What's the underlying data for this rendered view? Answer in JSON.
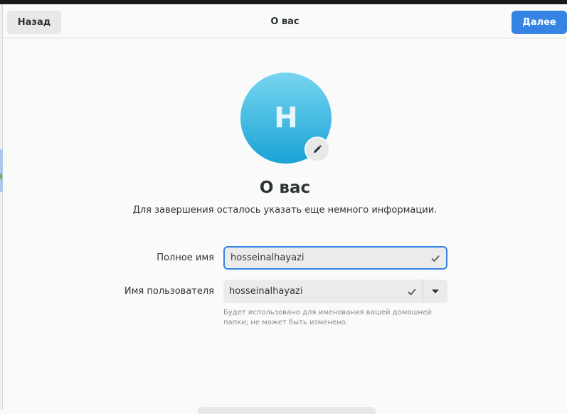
{
  "header": {
    "back_label": "Назад",
    "title": "О вас",
    "next_label": "Далее"
  },
  "avatar": {
    "initial": "H",
    "gradient_top": "#77d5f0",
    "gradient_bottom": "#1aa3d6",
    "edit_icon": "pencil-icon"
  },
  "main": {
    "title": "О вас",
    "subtitle": "Для завершения осталось указать еще немного информации."
  },
  "form": {
    "full_name_label": "Полное имя",
    "full_name_value": "hosseinalhayazi",
    "username_label": "Имя пользователя",
    "username_value": "hosseinalhayazi",
    "username_hint_line1": "Будет использовано для именования вашей домашней",
    "username_hint_line2": "папки; не может быть изменено."
  },
  "colors": {
    "accent": "#3584e4",
    "background": "#fafafa"
  }
}
